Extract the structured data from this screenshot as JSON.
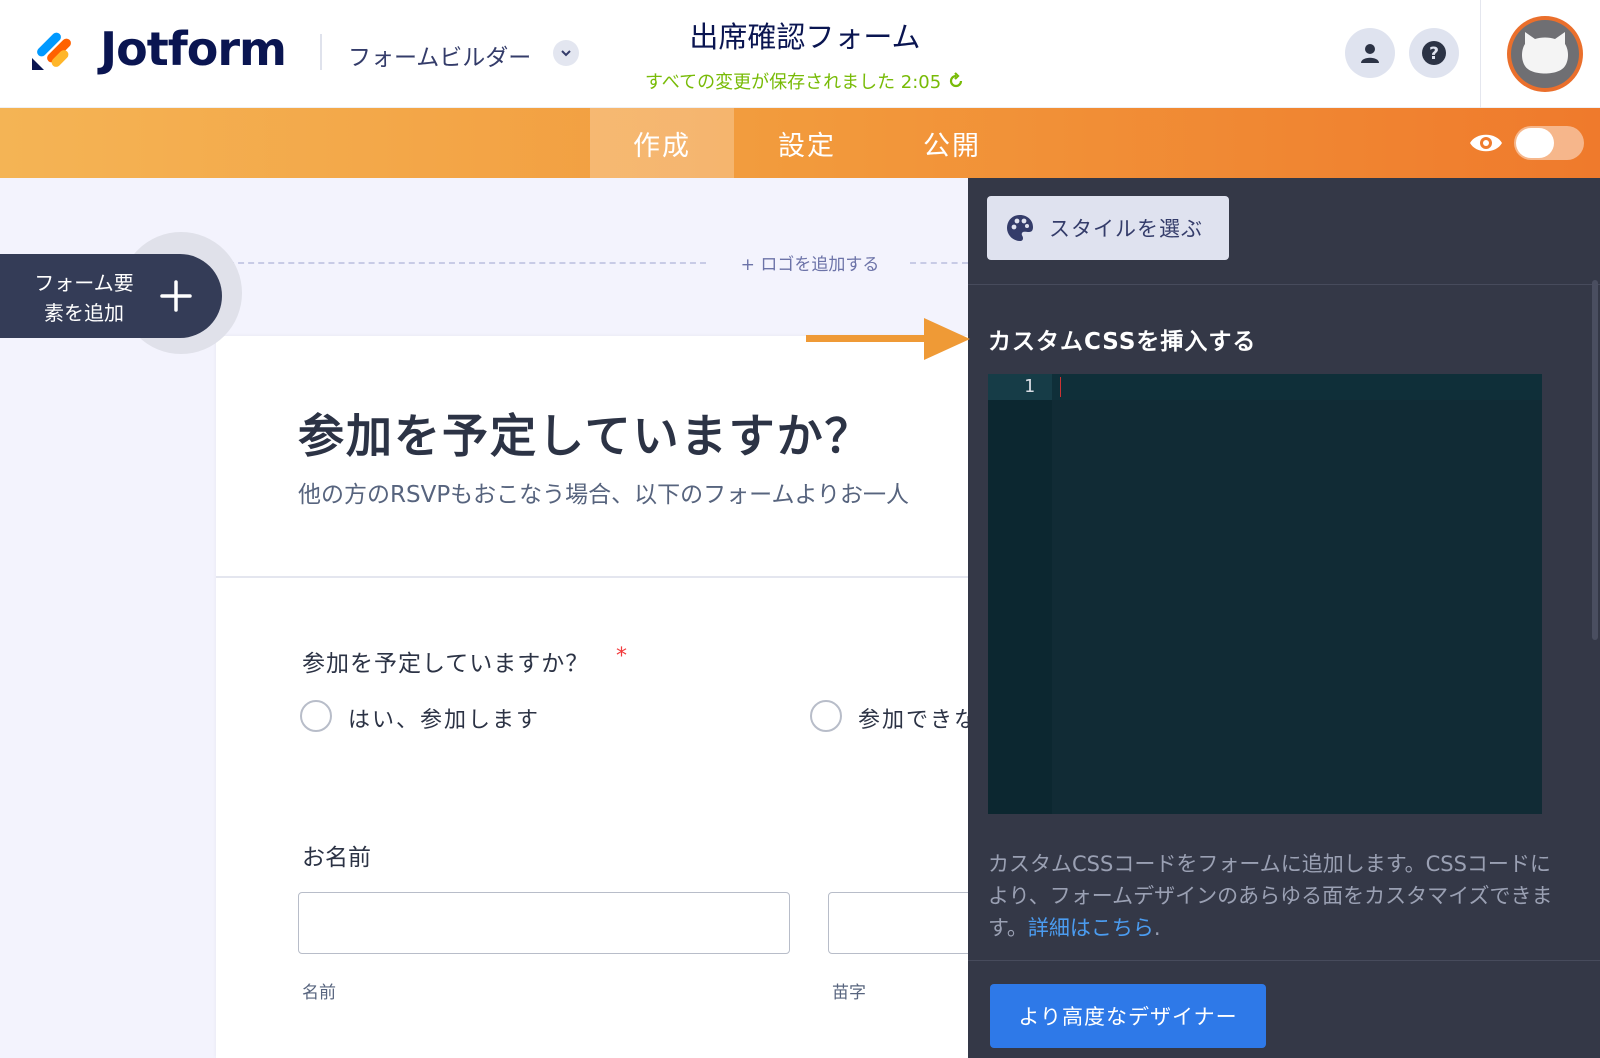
{
  "header": {
    "brand": "Jotform",
    "builder_label": "フォームビルダー",
    "form_title": "出席確認フォーム",
    "save_status": "すべての変更が保存されました 2:05"
  },
  "nav": {
    "tabs": [
      {
        "label": "作成",
        "active": true
      },
      {
        "label": "設定",
        "active": false
      },
      {
        "label": "公開",
        "active": false
      }
    ],
    "preview_toggle_on": false
  },
  "canvas": {
    "add_logo": "+ ロゴを追加する",
    "add_element_line1": "フォーム要",
    "add_element_line2": "素を追加",
    "heading": "参加を予定していますか？",
    "subheading": "他の方のRSVPもおこなう場合、以下のフォームよりお一人",
    "question": {
      "label": "参加を予定していますか？",
      "required_mark": "*",
      "options": [
        "はい、参加します",
        "参加できな"
      ]
    },
    "name_field": {
      "label": "お名前",
      "first_sublabel": "名前",
      "last_sublabel": "苗字"
    }
  },
  "panel": {
    "style_button": "スタイルを選ぶ",
    "css_title": "カスタムCSSを挿入する",
    "editor_line": "1",
    "help_text": "カスタムCSSコードをフォームに追加します。CSSコードにより、フォームデザインのあらゆる面をカスタマイズできます。",
    "help_link": "詳細はこちら",
    "help_end": ".",
    "advanced_button": "より高度なデザイナー"
  },
  "colors": {
    "accent_orange": "#f29a3c",
    "panel_bg": "#343847",
    "editor_bg": "#112b35",
    "primary_blue": "#2e79e8",
    "saved_green": "#78bb07"
  }
}
